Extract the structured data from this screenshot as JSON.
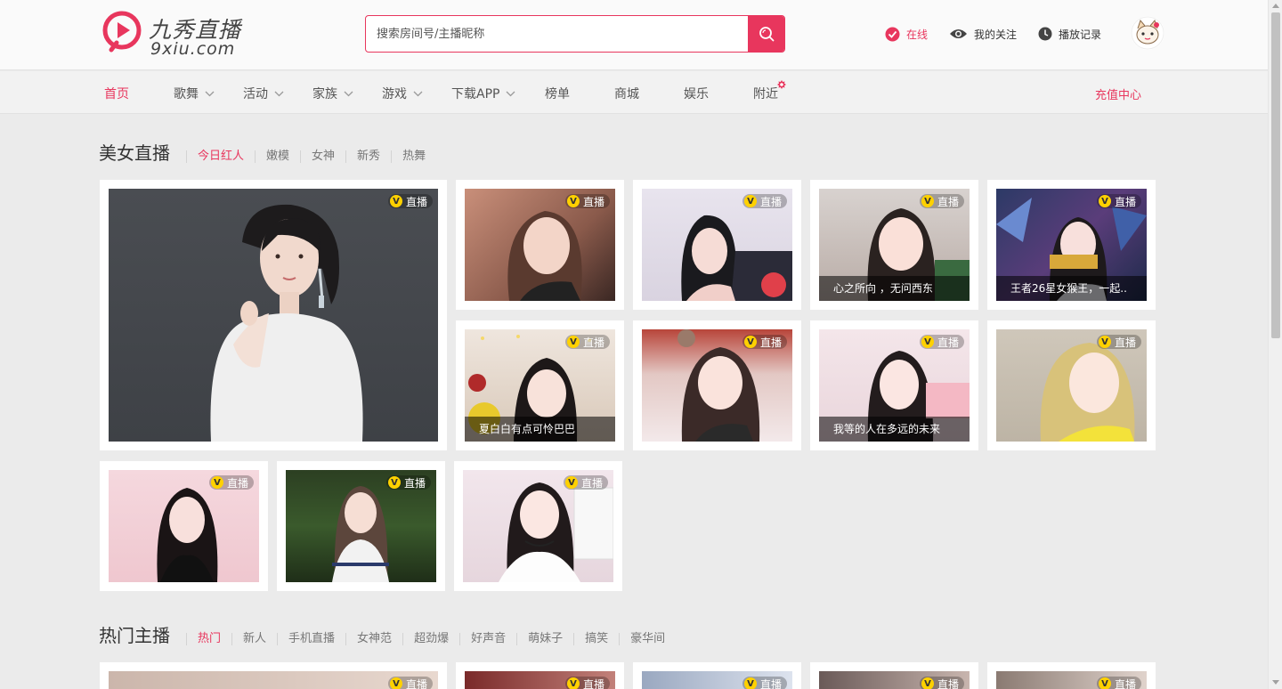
{
  "header": {
    "logo_cn": "九秀直播",
    "logo_en": "9xiu.com",
    "search_placeholder": "搜索房间号/主播昵称",
    "links": {
      "online": "在线",
      "follow": "我的关注",
      "history": "播放记录"
    }
  },
  "nav": {
    "items": [
      {
        "label": "首页",
        "active": true,
        "dropdown": false
      },
      {
        "label": "歌舞",
        "dropdown": true
      },
      {
        "label": "活动",
        "dropdown": true
      },
      {
        "label": "家族",
        "dropdown": true
      },
      {
        "label": "游戏",
        "dropdown": true
      },
      {
        "label": "下载APP",
        "dropdown": true
      },
      {
        "label": "榜单",
        "dropdown": false
      },
      {
        "label": "商城",
        "dropdown": false
      },
      {
        "label": "娱乐",
        "dropdown": false
      },
      {
        "label": "附近",
        "dropdown": false,
        "badge": "new"
      }
    ],
    "recharge": "充值中心"
  },
  "beauty": {
    "title": "美女直播",
    "tabs": [
      "今日红人",
      "嫩模",
      "女神",
      "新秀",
      "热舞"
    ],
    "live_badge": "直播",
    "live_v": "V",
    "captions": {
      "card4": "心之所向 ，无问西东",
      "card5": "王者26星女猴王，一起..",
      "card6": "夏白白有点可怜巴巴",
      "card8": "我等的人在多远的未来"
    }
  },
  "hot": {
    "title": "热门主播",
    "tabs": [
      "热门",
      "新人",
      "手机直播",
      "女神范",
      "超劲爆",
      "好声音",
      "萌妹子",
      "搞笑",
      "豪华间"
    ]
  },
  "colors": {
    "accent": "#e8365d",
    "badge": "#ffd100",
    "page_bg": "#ebebeb"
  },
  "icons": [
    "logo-play-icon",
    "search-icon",
    "check-circle-icon",
    "eye-icon",
    "clock-icon",
    "cat-avatar-icon",
    "chevron-down-icon",
    "new-badge-icon"
  ]
}
